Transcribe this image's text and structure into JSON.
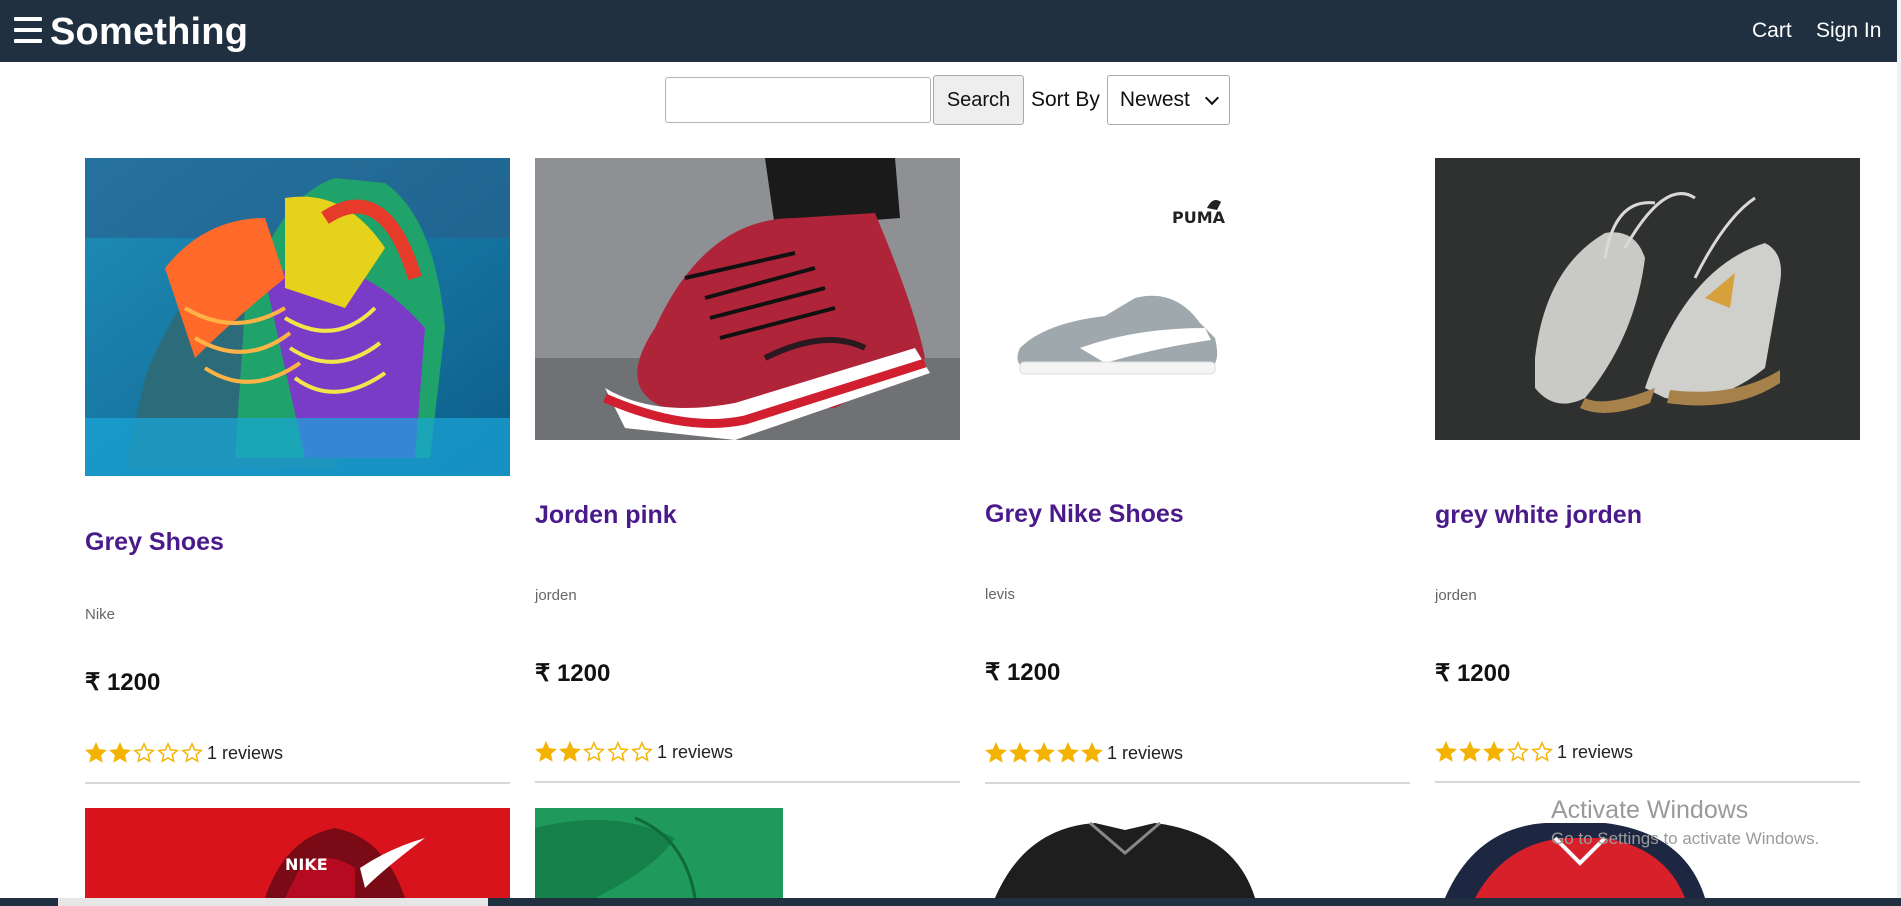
{
  "header": {
    "brand": "Something",
    "cart_label": "Cart",
    "signin_label": "Sign In"
  },
  "search": {
    "value": "",
    "placeholder": "",
    "button_label": "Search",
    "sort_label": "Sort By",
    "sort_selected": "Newest"
  },
  "products": [
    {
      "title": "Grey Shoes",
      "brand": "Nike",
      "price": "₹ 1200",
      "rating": 2,
      "reviews": "1 reviews"
    },
    {
      "title": "Jorden pink",
      "brand": "jorden",
      "price": "₹ 1200",
      "rating": 2,
      "reviews": "1 reviews"
    },
    {
      "title": "Grey Nike Shoes",
      "brand": "levis",
      "price": "₹ 1200",
      "rating": 5,
      "reviews": "1 reviews"
    },
    {
      "title": "grey white jorden",
      "brand": "jorden",
      "price": "₹ 1200",
      "rating": 3,
      "reviews": "1 reviews"
    }
  ],
  "image_labels": {
    "puma_logo": "PUMA",
    "nike_logo": "NIKE"
  },
  "watermark": {
    "line1": "Activate Windows",
    "line2": "Go to Settings to activate Windows."
  },
  "colors": {
    "header_bg": "#203040",
    "title": "#4b1a8a",
    "star": "#f5b301"
  }
}
